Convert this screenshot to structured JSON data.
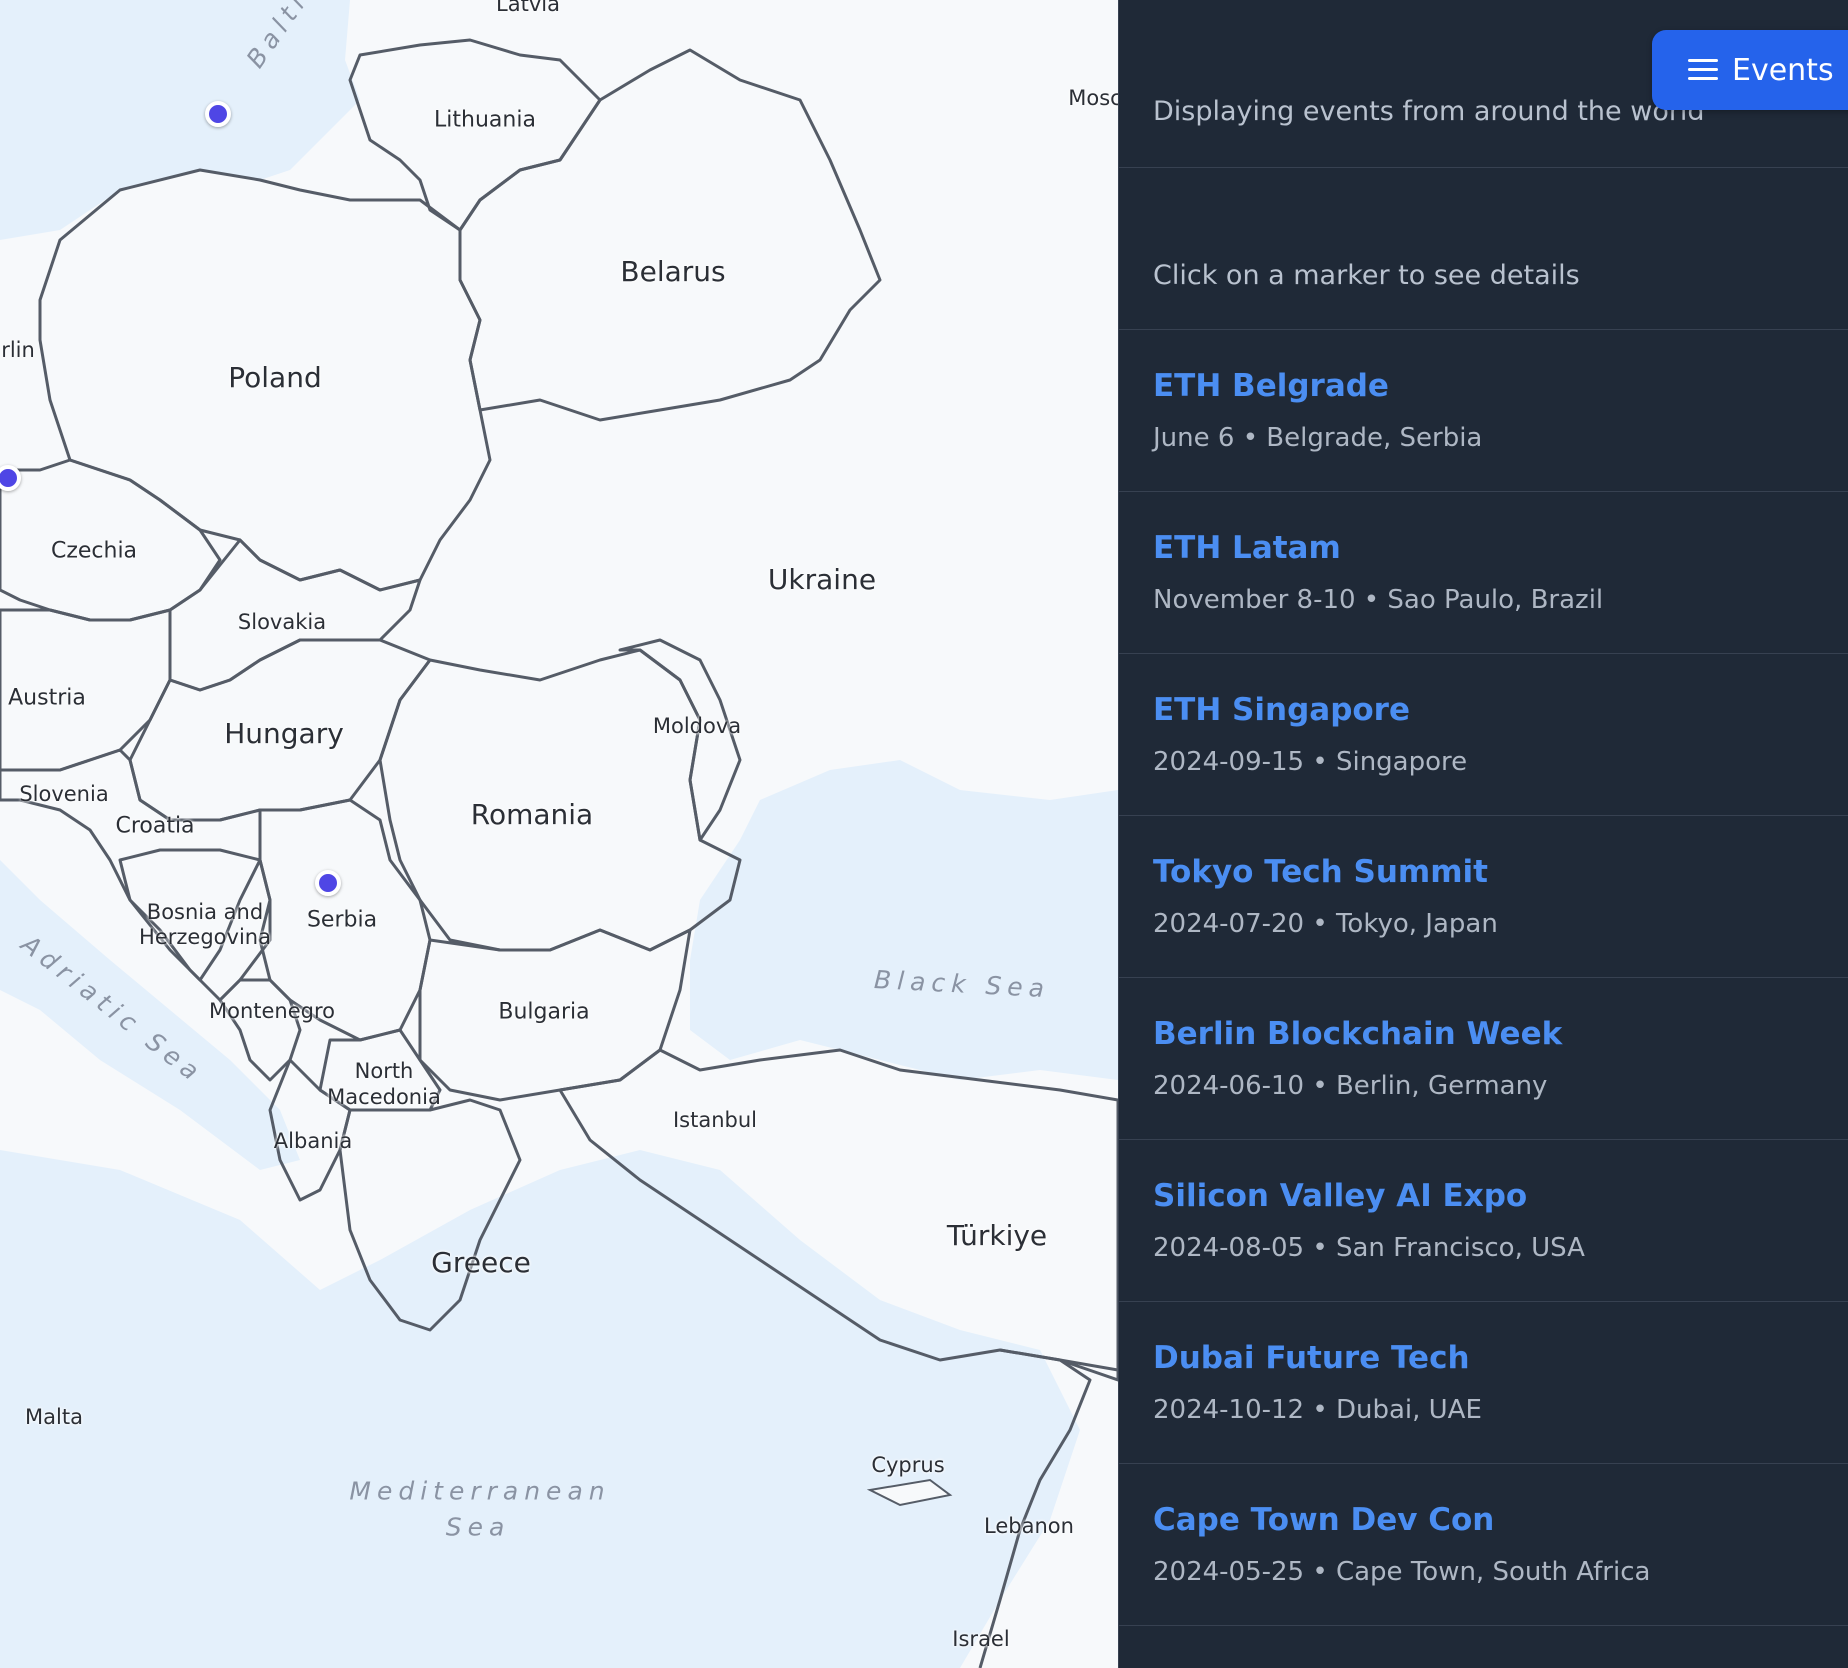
{
  "map": {
    "labels": {
      "latvia": "Latvia",
      "baltic": "Balti",
      "mosc": "Mosc",
      "lithuania": "Lithuania",
      "belarus": "Belarus",
      "berlin": "rlin",
      "poland": "Poland",
      "czechia": "Czechia",
      "ukraine": "Ukraine",
      "slovakia": "Slovakia",
      "austria": "Austria",
      "hungary": "Hungary",
      "moldova": "Moldova",
      "slovenia": "Slovenia",
      "croatia": "Croatia",
      "romania": "Romania",
      "bosnia1": "Bosnia and",
      "bosnia2": "Herzegovina",
      "serbia": "Serbia",
      "adriatic": "Adriatic Sea",
      "black_sea": "Black Sea",
      "montenegro": "Montenegro",
      "bulgaria": "Bulgaria",
      "north_macedonia1": "North",
      "north_macedonia2": "Macedonia",
      "istanbul": "Istanbul",
      "albania": "Albania",
      "turkiye": "Türkiye",
      "greece": "Greece",
      "malta": "Malta",
      "cyprus": "Cyprus",
      "mediterranean1": "Mediterranean",
      "mediterranean2": "Sea",
      "lebanon": "Lebanon",
      "israel": "Israel"
    },
    "marker_color": "#4f46e5"
  },
  "panel": {
    "events_button": "Events",
    "subtitle": "Displaying events from around the world",
    "hint": "Click on a marker to see details",
    "events": [
      {
        "title": "ETH Belgrade",
        "meta": "June 6 • Belgrade, Serbia"
      },
      {
        "title": "ETH Latam",
        "meta": "November 8-10 • Sao Paulo, Brazil"
      },
      {
        "title": "ETH Singapore",
        "meta": "2024-09-15 • Singapore"
      },
      {
        "title": "Tokyo Tech Summit",
        "meta": "2024-07-20 • Tokyo, Japan"
      },
      {
        "title": "Berlin Blockchain Week",
        "meta": "2024-06-10 • Berlin, Germany"
      },
      {
        "title": "Silicon Valley AI Expo",
        "meta": "2024-08-05 • San Francisco, USA"
      },
      {
        "title": "Dubai Future Tech",
        "meta": "2024-10-12 • Dubai, UAE"
      },
      {
        "title": "Cape Town Dev Con",
        "meta": "2024-05-25 • Cape Town, South Africa"
      }
    ],
    "accent": "#2563eb",
    "title_color": "#4b8ef2",
    "background": "#1f2937"
  }
}
